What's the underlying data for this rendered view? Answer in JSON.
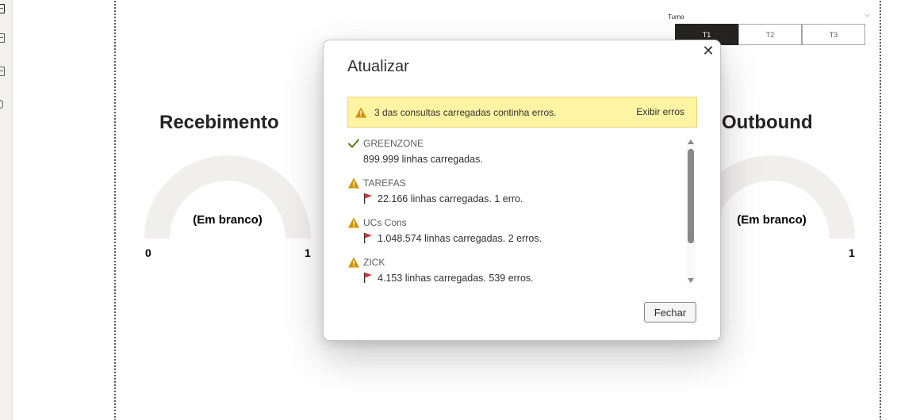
{
  "slicer": {
    "title": "Turno",
    "options": [
      "T1",
      "T2",
      "T3"
    ],
    "selected": "T1"
  },
  "gauges": [
    {
      "title": "Recebimento",
      "center_label": "(Em branco)",
      "min": "0",
      "max": "1"
    },
    {
      "title": "Outbound",
      "center_label": "(Em branco)",
      "min": "",
      "max": "1"
    }
  ],
  "dialog": {
    "title": "Atualizar",
    "close_icon": "close-icon",
    "banner": {
      "icon": "warning-icon",
      "text": "3 das consultas carregadas continha erros.",
      "link": "Exibir erros"
    },
    "items": [
      {
        "status": "success",
        "icon": "checkmark-icon",
        "name": "GREENZONE",
        "detail": "899.999 linhas carregadas."
      },
      {
        "status": "warning",
        "icon": "warning-icon",
        "name": "TAREFAS",
        "detail": "22.166 linhas carregadas. 1 erro."
      },
      {
        "status": "warning",
        "icon": "warning-icon",
        "name": "UCs Cons",
        "detail": "1.048.574 linhas carregadas. 2 erros."
      },
      {
        "status": "warning",
        "icon": "warning-icon",
        "name": "ZICK",
        "detail": "4.153 linhas carregadas. 539 erros."
      }
    ],
    "close_button": "Fechar"
  },
  "colors": {
    "banner_bg": "#fff4a3",
    "warning": "#d29200",
    "success": "#498205",
    "flag": "#d13438",
    "gauge_track": "#f0efee",
    "slicer_active": "#252423"
  }
}
